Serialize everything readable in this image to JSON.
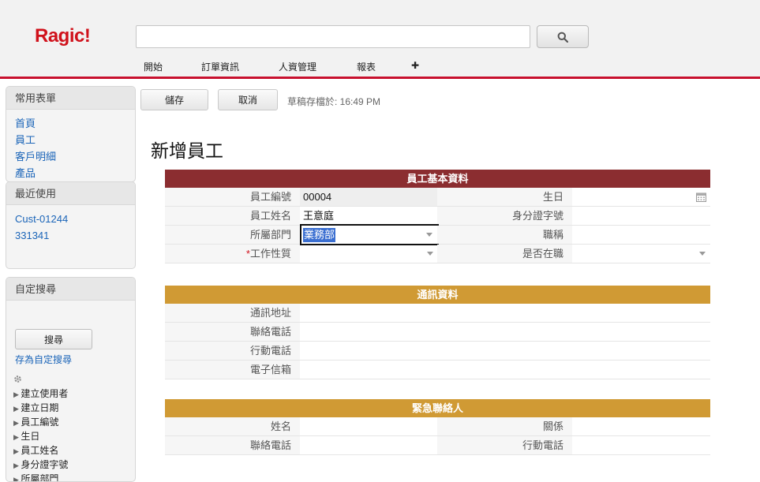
{
  "app": {
    "logo": "Ragic!"
  },
  "search": {
    "placeholder": ""
  },
  "nav": {
    "items": [
      "開始",
      "訂單資訊",
      "人資管理",
      "報表",
      "✚"
    ]
  },
  "sidebar": {
    "favorites": {
      "title": "常用表單",
      "items": [
        "首頁",
        "員工",
        "客戶明細",
        "產品"
      ]
    },
    "recent": {
      "title": "最近使用",
      "items": [
        "Cust-01244",
        "331341"
      ]
    },
    "custom_search": {
      "title": "自定搜尋",
      "search_button": "搜尋",
      "save_link": "存為自定搜尋",
      "fields": [
        "建立使用者",
        "建立日期",
        "員工編號",
        "生日",
        "員工姓名",
        "身分證字號",
        "所屬部門"
      ]
    }
  },
  "toolbar": {
    "save": "儲存",
    "cancel": "取消",
    "draft_status": "草稿存檔於: 16:49 PM"
  },
  "page": {
    "title": "新增員工"
  },
  "colors": {
    "accent_red": "#c8102e",
    "section_basic": "#8b2d30",
    "section_gold": "#d09a34",
    "link": "#1a64b8"
  },
  "sections": {
    "basic": {
      "title": "員工基本資料",
      "employee_id": {
        "label": "員工編號",
        "value": "00004"
      },
      "birthday": {
        "label": "生日",
        "value": ""
      },
      "name": {
        "label": "員工姓名",
        "value": "王意庭"
      },
      "id_number": {
        "label": "身分證字號",
        "value": ""
      },
      "department": {
        "label": "所屬部門",
        "value": "業務部"
      },
      "job_title": {
        "label": "職稱",
        "value": ""
      },
      "job_type": {
        "required_mark": "*",
        "label": "工作性質",
        "value": ""
      },
      "employed": {
        "label": "是否在職",
        "value": ""
      }
    },
    "contact": {
      "title": "通訊資料",
      "address": {
        "label": "通訊地址",
        "value": ""
      },
      "phone": {
        "label": "聯絡電話",
        "value": ""
      },
      "mobile": {
        "label": "行動電話",
        "value": ""
      },
      "email": {
        "label": "電子信箱",
        "value": ""
      }
    },
    "emergency": {
      "title": "緊急聯絡人",
      "name": {
        "label": "姓名",
        "value": ""
      },
      "relation": {
        "label": "關係",
        "value": ""
      },
      "phone": {
        "label": "聯絡電話",
        "value": ""
      },
      "mobile": {
        "label": "行動電話",
        "value": ""
      }
    }
  }
}
